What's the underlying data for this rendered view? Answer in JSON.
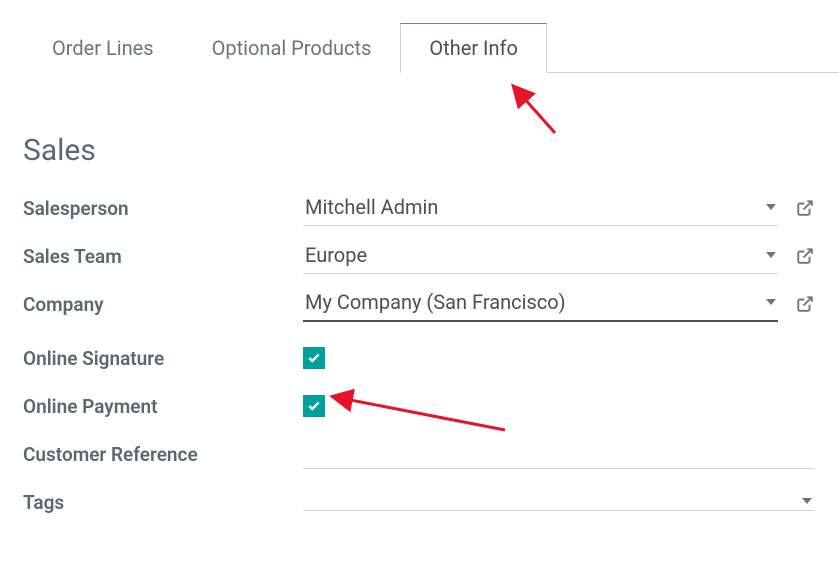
{
  "tabs": {
    "order_lines": "Order Lines",
    "optional_products": "Optional Products",
    "other_info": "Other Info"
  },
  "section_title": "Sales",
  "fields": {
    "salesperson": {
      "label": "Salesperson",
      "value": "Mitchell Admin"
    },
    "sales_team": {
      "label": "Sales Team",
      "value": "Europe"
    },
    "company": {
      "label": "Company",
      "value": "My Company (San Francisco)"
    },
    "online_signature": {
      "label": "Online Signature",
      "checked": true
    },
    "online_payment": {
      "label": "Online Payment",
      "checked": true
    },
    "customer_reference": {
      "label": "Customer Reference"
    },
    "tags": {
      "label": "Tags"
    }
  }
}
